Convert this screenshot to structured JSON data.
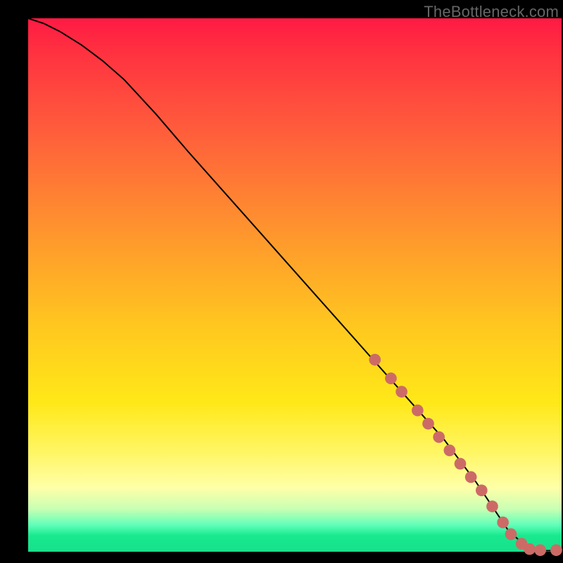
{
  "watermark": "TheBottleneck.com",
  "colors": {
    "frame_background": "#000000",
    "gradient_top": "#ff1a44",
    "gradient_mid1": "#ff8f2f",
    "gradient_mid2": "#ffe818",
    "gradient_bottom": "#18e08c",
    "curve": "#000000",
    "marker": "#cc6b66"
  },
  "chart_data": {
    "type": "line",
    "title": "",
    "xlabel": "",
    "ylabel": "",
    "xlim": [
      0,
      100
    ],
    "ylim": [
      0,
      100
    ],
    "grid": false,
    "legend": false,
    "series": [
      {
        "name": "curve",
        "x": [
          0,
          3,
          6,
          10,
          14,
          18,
          24,
          30,
          38,
          46,
          54,
          62,
          70,
          78,
          84,
          88,
          90,
          93,
          95,
          97,
          99,
          100
        ],
        "y": [
          100,
          99,
          97.5,
          95,
          92,
          88.5,
          82,
          75,
          66,
          57,
          48,
          39,
          30,
          21,
          13,
          7,
          4,
          1.3,
          0.4,
          0.2,
          0.2,
          0.2
        ]
      }
    ],
    "markers": {
      "name": "highlighted-segment",
      "points": [
        {
          "x": 65,
          "y": 36
        },
        {
          "x": 68,
          "y": 32.5
        },
        {
          "x": 70,
          "y": 30
        },
        {
          "x": 73,
          "y": 26.5
        },
        {
          "x": 75,
          "y": 24
        },
        {
          "x": 77,
          "y": 21.5
        },
        {
          "x": 79,
          "y": 19
        },
        {
          "x": 81,
          "y": 16.5
        },
        {
          "x": 83,
          "y": 14
        },
        {
          "x": 85,
          "y": 11.5
        },
        {
          "x": 87,
          "y": 8.5
        },
        {
          "x": 89,
          "y": 5.5
        },
        {
          "x": 90.5,
          "y": 3.3
        },
        {
          "x": 92.5,
          "y": 1.5
        },
        {
          "x": 94,
          "y": 0.5
        },
        {
          "x": 96,
          "y": 0.3
        },
        {
          "x": 99,
          "y": 0.3
        }
      ],
      "radius_data_units": 1.1
    }
  }
}
